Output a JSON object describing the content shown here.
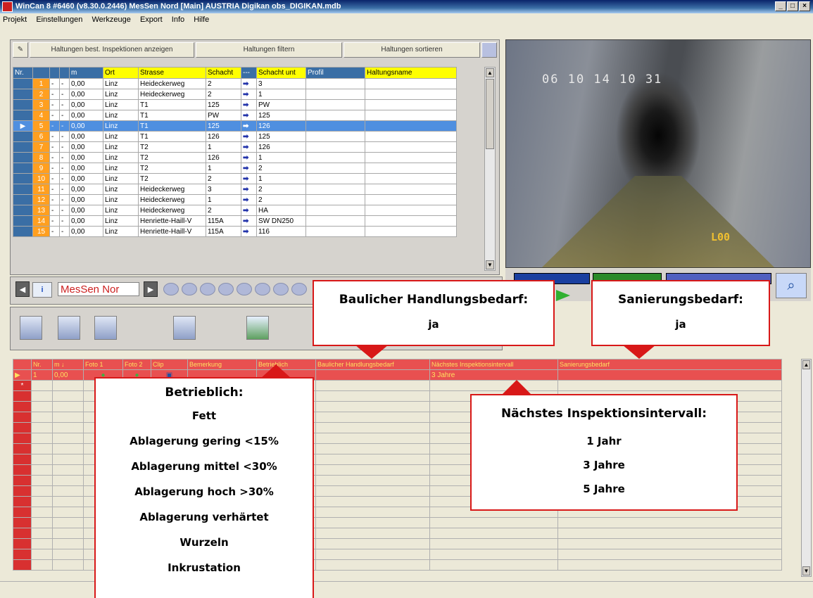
{
  "window": {
    "title": "WinCan 8 #6460 (v8.30.0.2446) MesSen Nord [Main] AUSTRIA Digikan obs_DIGIKAN.mdb",
    "min": "_",
    "max": "□",
    "close": "×"
  },
  "menu": [
    "Projekt",
    "Einstellungen",
    "Werkzeuge",
    "Export",
    "Info",
    "Hilfe"
  ],
  "toolbar": {
    "show_inspections": "Haltungen best. Inspektionen anzeigen",
    "filter": "Haltungen filtern",
    "sort": "Haltungen sortieren"
  },
  "upper_grid": {
    "headers": [
      "Nr.",
      "m",
      "Ort",
      "Strasse",
      "Schacht",
      "---",
      "Schacht unt",
      "Profil",
      "Haltungsname"
    ],
    "rows": [
      {
        "nr": "1",
        "m": "0,00",
        "ort": "Linz",
        "strasse": "Heideckerweg",
        "schacht": "2",
        "schacht_unt": "3"
      },
      {
        "nr": "2",
        "m": "0,00",
        "ort": "Linz",
        "strasse": "Heideckerweg",
        "schacht": "2",
        "schacht_unt": "1"
      },
      {
        "nr": "3",
        "m": "0,00",
        "ort": "Linz",
        "strasse": "T1",
        "schacht": "125",
        "schacht_unt": "PW"
      },
      {
        "nr": "4",
        "m": "0,00",
        "ort": "Linz",
        "strasse": "T1",
        "schacht": "PW",
        "schacht_unt": "125"
      },
      {
        "nr": "5",
        "m": "0,00",
        "ort": "Linz",
        "strasse": "T1",
        "schacht": "125",
        "schacht_unt": "126"
      },
      {
        "nr": "6",
        "m": "0,00",
        "ort": "Linz",
        "strasse": "T1",
        "schacht": "126",
        "schacht_unt": "125"
      },
      {
        "nr": "7",
        "m": "0,00",
        "ort": "Linz",
        "strasse": "T2",
        "schacht": "1",
        "schacht_unt": "126"
      },
      {
        "nr": "8",
        "m": "0,00",
        "ort": "Linz",
        "strasse": "T2",
        "schacht": "126",
        "schacht_unt": "1"
      },
      {
        "nr": "9",
        "m": "0,00",
        "ort": "Linz",
        "strasse": "T2",
        "schacht": "1",
        "schacht_unt": "2"
      },
      {
        "nr": "10",
        "m": "0,00",
        "ort": "Linz",
        "strasse": "T2",
        "schacht": "2",
        "schacht_unt": "1"
      },
      {
        "nr": "11",
        "m": "0,00",
        "ort": "Linz",
        "strasse": "Heideckerweg",
        "schacht": "3",
        "schacht_unt": "2"
      },
      {
        "nr": "12",
        "m": "0,00",
        "ort": "Linz",
        "strasse": "Heideckerweg",
        "schacht": "1",
        "schacht_unt": "2"
      },
      {
        "nr": "13",
        "m": "0,00",
        "ort": "Linz",
        "strasse": "Heideckerweg",
        "schacht": "2",
        "schacht_unt": "HA"
      },
      {
        "nr": "14",
        "m": "0,00",
        "ort": "Linz",
        "strasse": "Henriette-Haill-V",
        "schacht": "115A",
        "schacht_unt": "SW DN250"
      },
      {
        "nr": "15",
        "m": "0,00",
        "ort": "Linz",
        "strasse": "Henriette-Haill-V",
        "schacht": "115A",
        "schacht_unt": "116"
      }
    ],
    "dash": "-",
    "arrow": "➡"
  },
  "video": {
    "timestamp": "06 10 14   10 31",
    "distance": "L00"
  },
  "nav": {
    "name": "MesSen Nor",
    "prev": "◀",
    "next": "▶",
    "info": "i"
  },
  "lower_grid": {
    "headers": [
      "Nr.",
      "m ↓",
      "Foto 1",
      "Foto 2",
      "Clip",
      "Bemerkung",
      "Betrieblich",
      "Baulicher Handlungsbedarf",
      "Nächstes Inspektionsintervall",
      "Sanierungsbedarf"
    ],
    "row": {
      "nr": "1",
      "m": "0,00",
      "interval": "3 Jahre"
    },
    "new_marker": "*"
  },
  "callouts": {
    "baulich": {
      "title": "Baulicher Handlungsbedarf:",
      "value": "ja"
    },
    "sanierung": {
      "title": "Sanierungsbedarf:",
      "value": "ja"
    },
    "betrieblich": {
      "title": "Betrieblich:",
      "items": [
        "Fett",
        "Ablagerung gering <15%",
        "Ablagerung mittel <30%",
        "Ablagerung hoch >30%",
        "Ablagerung verhärtet",
        "Wurzeln",
        "Inkrustation"
      ]
    },
    "intervall": {
      "title": "Nächstes Inspektionsintervall:",
      "items": [
        "1 Jahr",
        "3 Jahre",
        "5 Jahre"
      ]
    }
  }
}
